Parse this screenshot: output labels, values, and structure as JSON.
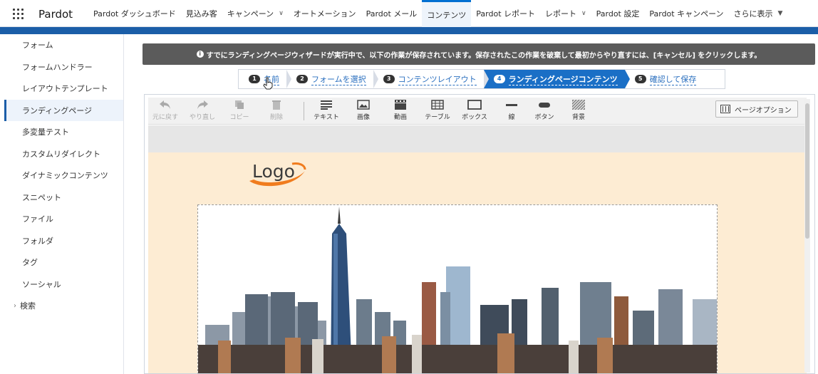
{
  "app": {
    "name": "Pardot"
  },
  "nav": {
    "items": [
      {
        "label": "Pardot ダッシュボード",
        "dropdown": false
      },
      {
        "label": "見込み客",
        "dropdown": false
      },
      {
        "label": "キャンペーン",
        "dropdown": true
      },
      {
        "label": "オートメーション",
        "dropdown": false
      },
      {
        "label": "Pardot メール",
        "dropdown": false
      },
      {
        "label": "コンテンツ",
        "dropdown": false,
        "active": true
      },
      {
        "label": "Pardot レポート",
        "dropdown": false
      },
      {
        "label": "レポート",
        "dropdown": true
      },
      {
        "label": "Pardot 設定",
        "dropdown": false
      },
      {
        "label": "Pardot キャンペーン",
        "dropdown": false
      },
      {
        "label": "さらに表示",
        "dropdown": true
      }
    ]
  },
  "sidebar": {
    "items": [
      {
        "label": "フォーム"
      },
      {
        "label": "フォームハンドラー"
      },
      {
        "label": "レイアウトテンプレート"
      },
      {
        "label": "ランディングページ",
        "active": true
      },
      {
        "label": "多変量テスト"
      },
      {
        "label": "カスタムリダイレクト"
      },
      {
        "label": "ダイナミックコンテンツ"
      },
      {
        "label": "スニペット"
      },
      {
        "label": "ファイル"
      },
      {
        "label": "フォルダ"
      },
      {
        "label": "タグ"
      },
      {
        "label": "ソーシャル"
      },
      {
        "label": "検索",
        "expandable": true
      }
    ]
  },
  "alert": {
    "text": "すでにランディングページウィザードが実行中で、以下の作業が保存されています。保存されたこの作業を破棄して最初からやり直すには、[キャンセル] をクリックします。"
  },
  "wizard": {
    "steps": [
      {
        "num": "1",
        "label": "名前"
      },
      {
        "num": "2",
        "label": "フォームを選択"
      },
      {
        "num": "3",
        "label": "コンテンツレイアウト"
      },
      {
        "num": "4",
        "label": "ランディングページコンテンツ",
        "active": true
      },
      {
        "num": "5",
        "label": "確認して保存"
      }
    ]
  },
  "toolbar": {
    "undo": "元に戻す",
    "redo": "やり直し",
    "copy": "コピー",
    "delete": "削除",
    "text": "テキスト",
    "image": "画像",
    "video": "動画",
    "table": "テーブル",
    "box": "ボックス",
    "line": "線",
    "button": "ボタン",
    "background": "背景",
    "page_options": "ページオプション"
  },
  "canvas": {
    "logo_text": "Logo",
    "background_color": "#fdecd3"
  },
  "colors": {
    "accent": "#1a6fc6",
    "header_band": "#1b5ea8",
    "alert_bg": "#5b5b5b"
  }
}
